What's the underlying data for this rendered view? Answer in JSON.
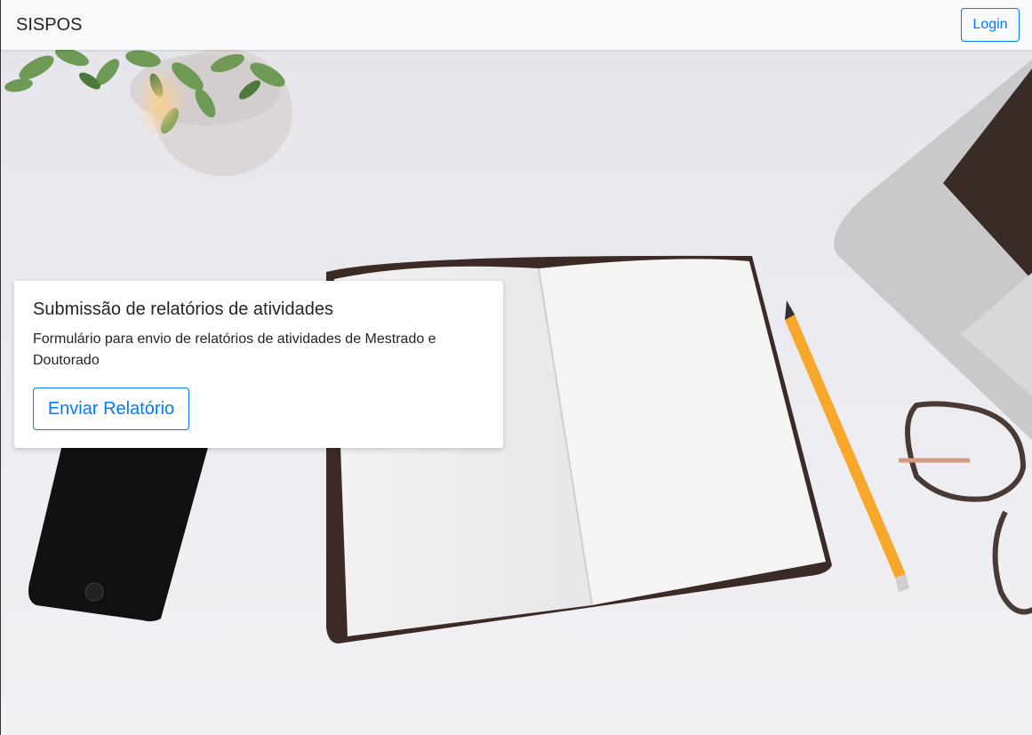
{
  "navbar": {
    "brand": "SISPOS",
    "login_label": "Login"
  },
  "card": {
    "title": "Submissão de relatórios de atividades",
    "text": "Formulário para envio de relatórios de atividades de Mestrado e Doutorado",
    "button_label": "Enviar Relatório"
  },
  "colors": {
    "primary": "#007bff",
    "navbar_bg": "#f8f9fa",
    "text": "#212529"
  },
  "background": {
    "image": "desk-flatlay-photo"
  }
}
